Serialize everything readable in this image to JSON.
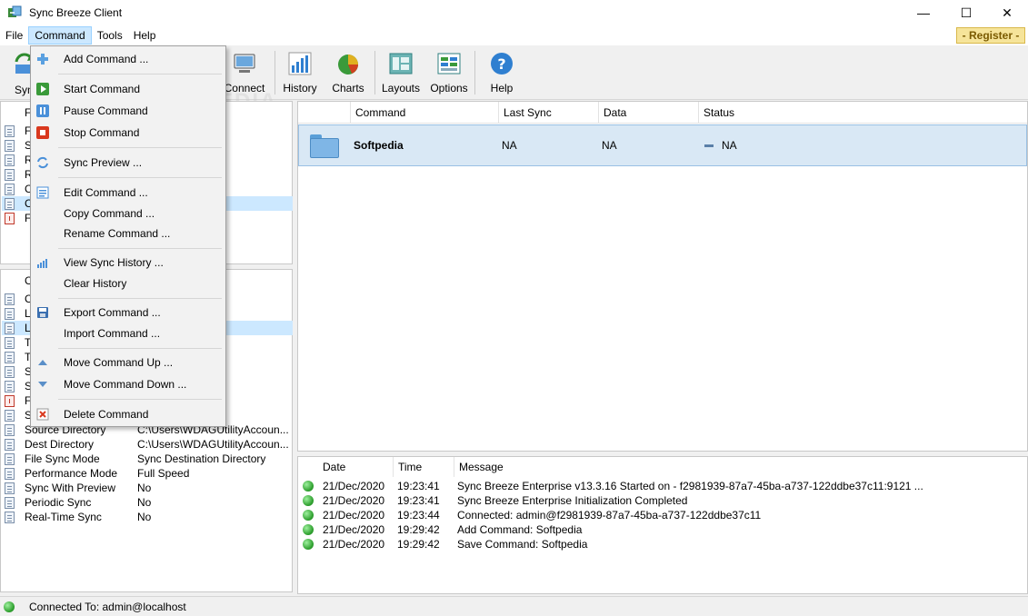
{
  "window": {
    "title": "Sync Breeze Client",
    "min": "—",
    "max": "☐",
    "close": "✕"
  },
  "menubar": {
    "items": [
      "File",
      "Command",
      "Tools",
      "Help"
    ],
    "register": "- Register -"
  },
  "toolbar": {
    "items": [
      {
        "label": "Syn",
        "icon": "sync-icon"
      },
      {
        "label": "Connect",
        "icon": "connect-icon"
      },
      {
        "label": "History",
        "icon": "history-chart-icon"
      },
      {
        "label": "Charts",
        "icon": "pie-chart-icon"
      },
      {
        "label": "Layouts",
        "icon": "layouts-icon"
      },
      {
        "label": "Options",
        "icon": "options-icon"
      },
      {
        "label": "Help",
        "icon": "help-icon"
      }
    ]
  },
  "watermark": "SOFTPEDIA",
  "left_top": {
    "header": "F",
    "items": [
      "F",
      "S",
      "R",
      "R",
      "C",
      "C",
      "F"
    ]
  },
  "left_bottom": {
    "header": "C",
    "items": [
      "C",
      "L",
      "L",
      "T",
      "T",
      "S",
      "S",
      "F",
      "S"
    ],
    "properties": [
      {
        "name": "Source Directory",
        "value": "C:\\Users\\WDAGUtilityAccoun..."
      },
      {
        "name": "Dest Directory",
        "value": "C:\\Users\\WDAGUtilityAccoun..."
      },
      {
        "name": "File Sync Mode",
        "value": "Sync Destination Directory"
      },
      {
        "name": "Performance Mode",
        "value": "Full Speed"
      },
      {
        "name": "Sync With Preview",
        "value": "No"
      },
      {
        "name": "Periodic Sync",
        "value": "No"
      },
      {
        "name": "Real-Time Sync",
        "value": "No"
      }
    ]
  },
  "commands": {
    "columns": [
      "Command",
      "Last Sync",
      "Data",
      "Status"
    ],
    "rows": [
      {
        "command": "Softpedia",
        "last_sync": "NA",
        "data": "NA",
        "status": "NA"
      }
    ]
  },
  "log": {
    "columns": [
      "Date",
      "Time",
      "Message"
    ],
    "rows": [
      {
        "date": "21/Dec/2020",
        "time": "19:23:41",
        "message": "Sync Breeze Enterprise v13.3.16 Started on - f2981939-87a7-45ba-a737-122ddbe37c11:9121 ..."
      },
      {
        "date": "21/Dec/2020",
        "time": "19:23:41",
        "message": "Sync Breeze Enterprise Initialization Completed"
      },
      {
        "date": "21/Dec/2020",
        "time": "19:23:44",
        "message": "Connected: admin@f2981939-87a7-45ba-a737-122ddbe37c11"
      },
      {
        "date": "21/Dec/2020",
        "time": "19:29:42",
        "message": "Add Command: Softpedia"
      },
      {
        "date": "21/Dec/2020",
        "time": "19:29:42",
        "message": "Save Command: Softpedia"
      }
    ]
  },
  "statusbar": {
    "text": "Connected To: admin@localhost"
  },
  "command_menu": {
    "items": [
      {
        "label": "Add Command ...",
        "icon": "add-icon"
      },
      {
        "label": "Start Command",
        "icon": "play-icon"
      },
      {
        "label": "Pause Command",
        "icon": "pause-icon"
      },
      {
        "label": "Stop Command",
        "icon": "stop-icon"
      },
      {
        "label": "Sync Preview ...",
        "icon": "preview-icon"
      },
      {
        "label": "Edit Command ...",
        "icon": "edit-icon"
      },
      {
        "label": "Copy Command ...",
        "icon": ""
      },
      {
        "label": "Rename Command ...",
        "icon": ""
      },
      {
        "label": "View Sync History ...",
        "icon": "history-icon"
      },
      {
        "label": "Clear History",
        "icon": ""
      },
      {
        "label": "Export Command ...",
        "icon": "save-icon"
      },
      {
        "label": "Import Command ...",
        "icon": ""
      },
      {
        "label": "Move Command Up ...",
        "icon": "arrow-up-icon"
      },
      {
        "label": "Move Command Down ...",
        "icon": "arrow-down-icon"
      },
      {
        "label": "Delete Command",
        "icon": "delete-icon"
      }
    ]
  },
  "colors": {
    "selection": "#cce8ff",
    "accent": "#2f7fd0",
    "register_bg": "#f6e49a"
  }
}
